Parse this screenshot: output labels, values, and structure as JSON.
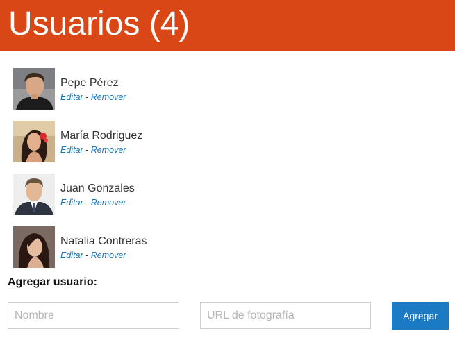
{
  "header": {
    "title": "Usuarios (4)"
  },
  "users": [
    {
      "name": "Pepe Pérez",
      "edit": "Editar",
      "separator": " - ",
      "remove": "Remover"
    },
    {
      "name": "María Rodriguez",
      "edit": "Editar",
      "separator": " - ",
      "remove": "Remover"
    },
    {
      "name": "Juan Gonzales",
      "edit": "Editar",
      "separator": " - ",
      "remove": "Remover"
    },
    {
      "name": "Natalia Contreras",
      "edit": "Editar",
      "separator": " - ",
      "remove": "Remover"
    }
  ],
  "add_form": {
    "title": "Agregar usuario:",
    "name_placeholder": "Nombre",
    "photo_placeholder": "URL de fotografía",
    "submit_label": "Agregar"
  },
  "colors": {
    "header_bg": "#d94716",
    "link": "#1a73b5",
    "button_bg": "#1a7ac4"
  }
}
